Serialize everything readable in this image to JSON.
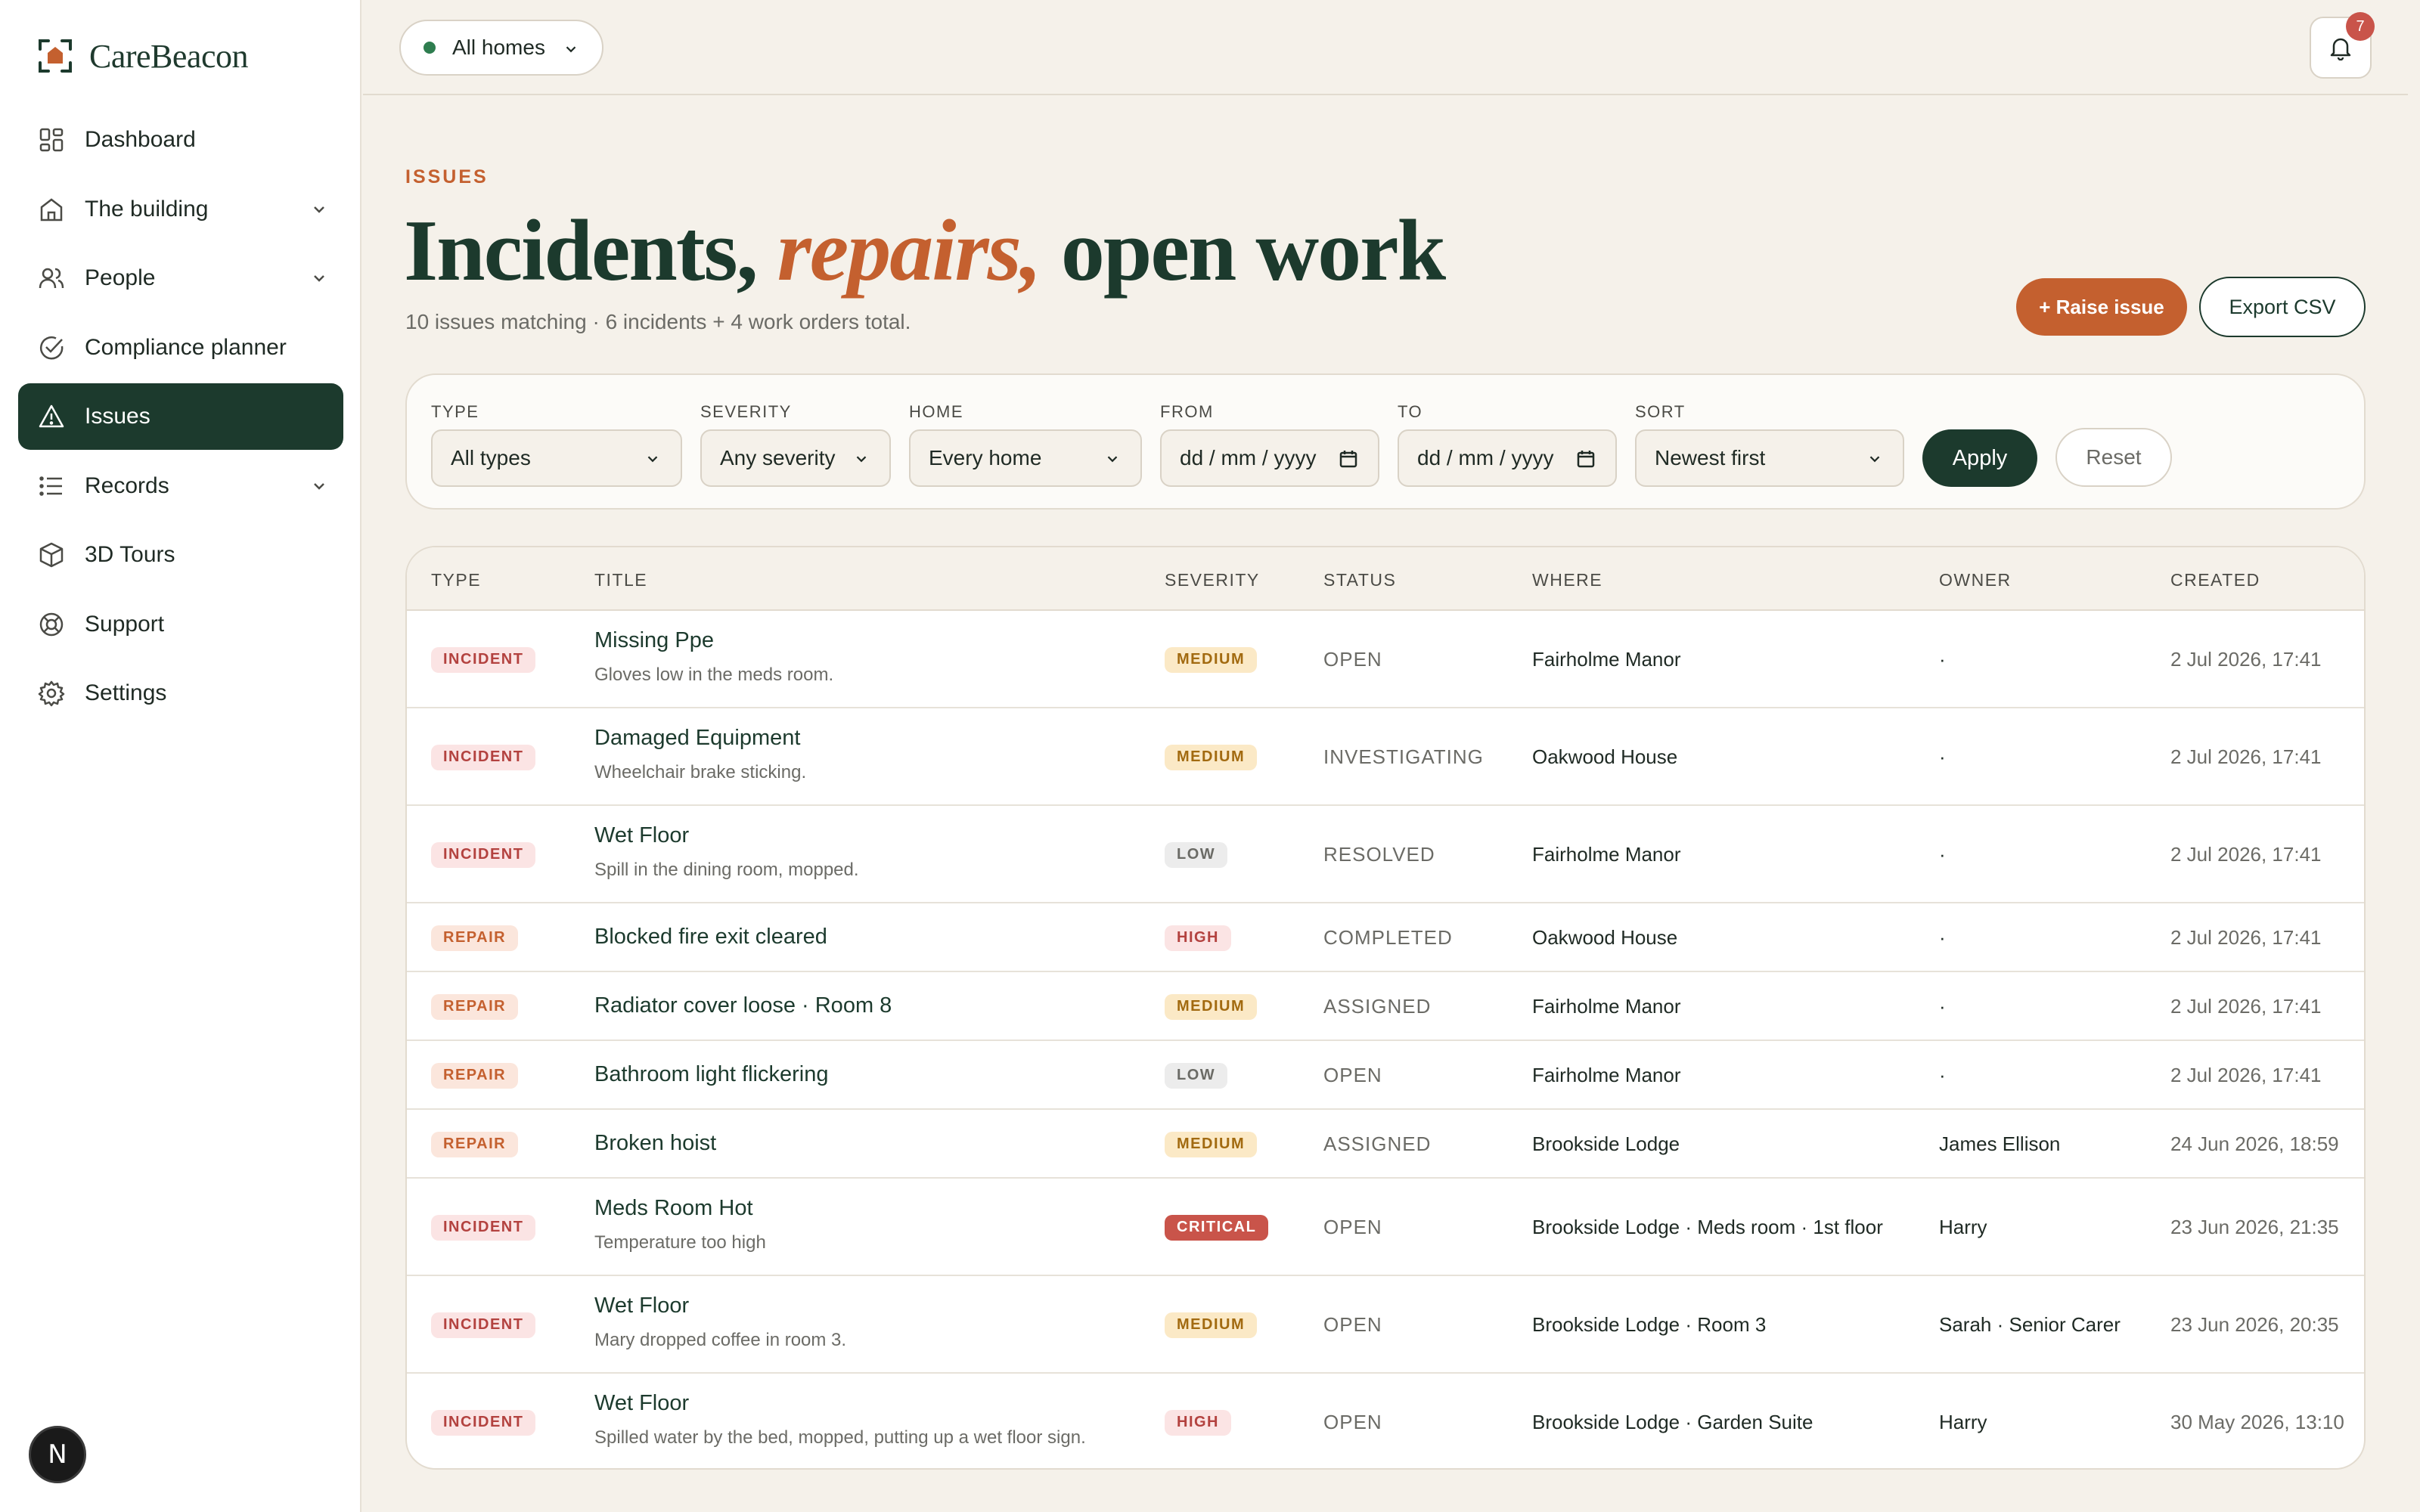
{
  "brand": {
    "name": "CareBeacon"
  },
  "sidebar": {
    "items": [
      {
        "label": "Dashboard",
        "icon": "dashboard-grid-icon",
        "expandable": false,
        "active": false
      },
      {
        "label": "The building",
        "icon": "building-icon",
        "expandable": true,
        "active": false
      },
      {
        "label": "People",
        "icon": "people-icon",
        "expandable": true,
        "active": false
      },
      {
        "label": "Compliance planner",
        "icon": "check-circle-icon",
        "expandable": false,
        "active": false
      },
      {
        "label": "Issues",
        "icon": "warning-triangle-icon",
        "expandable": false,
        "active": true
      },
      {
        "label": "Records",
        "icon": "list-icon",
        "expandable": true,
        "active": false
      },
      {
        "label": "3D Tours",
        "icon": "cube-icon",
        "expandable": false,
        "active": false
      },
      {
        "label": "Support",
        "icon": "lifebuoy-icon",
        "expandable": false,
        "active": false
      },
      {
        "label": "Settings",
        "icon": "gear-icon",
        "expandable": false,
        "active": false
      }
    ],
    "badge": "N"
  },
  "topbar": {
    "home_select": "All homes",
    "notifications_count": "7"
  },
  "header": {
    "eyebrow": "ISSUES",
    "title_part1": "Incidents, ",
    "title_accent": "repairs,",
    "title_part2": " open work",
    "subtitle": "10 issues matching · 6 incidents + 4 work orders total.",
    "raise_label": "+ Raise issue",
    "export_label": "Export CSV"
  },
  "filters": {
    "type": {
      "label": "TYPE",
      "value": "All types"
    },
    "severity": {
      "label": "SEVERITY",
      "value": "Any severity"
    },
    "home": {
      "label": "HOME",
      "value": "Every home"
    },
    "from": {
      "label": "FROM",
      "value": "dd / mm / yyyy"
    },
    "to": {
      "label": "TO",
      "value": "dd / mm / yyyy"
    },
    "sort": {
      "label": "SORT",
      "value": "Newest first"
    },
    "apply_label": "Apply",
    "reset_label": "Reset"
  },
  "table": {
    "columns": [
      "TYPE",
      "TITLE",
      "SEVERITY",
      "STATUS",
      "WHERE",
      "OWNER",
      "CREATED"
    ],
    "rows": [
      {
        "type": "INCIDENT",
        "title": "Missing Ppe",
        "sub": "Gloves low in the meds room.",
        "severity": "MEDIUM",
        "status": "OPEN",
        "where": "Fairholme Manor",
        "owner": "·",
        "created": "2 Jul 2026, 17:41"
      },
      {
        "type": "INCIDENT",
        "title": "Damaged Equipment",
        "sub": "Wheelchair brake sticking.",
        "severity": "MEDIUM",
        "status": "INVESTIGATING",
        "where": "Oakwood House",
        "owner": "·",
        "created": "2 Jul 2026, 17:41"
      },
      {
        "type": "INCIDENT",
        "title": "Wet Floor",
        "sub": "Spill in the dining room, mopped.",
        "severity": "LOW",
        "status": "RESOLVED",
        "where": "Fairholme Manor",
        "owner": "·",
        "created": "2 Jul 2026, 17:41"
      },
      {
        "type": "REPAIR",
        "title": "Blocked fire exit cleared",
        "sub": "",
        "severity": "HIGH",
        "status": "COMPLETED",
        "where": "Oakwood House",
        "owner": "·",
        "created": "2 Jul 2026, 17:41"
      },
      {
        "type": "REPAIR",
        "title": "Radiator cover loose · Room 8",
        "sub": "",
        "severity": "MEDIUM",
        "status": "ASSIGNED",
        "where": "Fairholme Manor",
        "owner": "·",
        "created": "2 Jul 2026, 17:41"
      },
      {
        "type": "REPAIR",
        "title": "Bathroom light flickering",
        "sub": "",
        "severity": "LOW",
        "status": "OPEN",
        "where": "Fairholme Manor",
        "owner": "·",
        "created": "2 Jul 2026, 17:41"
      },
      {
        "type": "REPAIR",
        "title": "Broken hoist",
        "sub": "",
        "severity": "MEDIUM",
        "status": "ASSIGNED",
        "where": "Brookside Lodge",
        "owner": "James Ellison",
        "created": "24 Jun 2026, 18:59"
      },
      {
        "type": "INCIDENT",
        "title": "Meds Room Hot",
        "sub": "Temperature too high",
        "severity": "CRITICAL",
        "status": "OPEN",
        "where": "Brookside Lodge · Meds room · 1st floor",
        "owner": "Harry",
        "created": "23 Jun 2026, 21:35"
      },
      {
        "type": "INCIDENT",
        "title": "Wet Floor",
        "sub": "Mary dropped coffee in room 3.",
        "severity": "MEDIUM",
        "status": "OPEN",
        "where": "Brookside Lodge · Room 3",
        "owner": "Sarah · Senior Carer",
        "created": "23 Jun 2026, 20:35"
      },
      {
        "type": "INCIDENT",
        "title": "Wet Floor",
        "sub": "Spilled water by the bed, mopped, putting up a wet floor sign.",
        "severity": "HIGH",
        "status": "OPEN",
        "where": "Brookside Lodge · Garden Suite",
        "owner": "Harry",
        "created": "30 May 2026, 13:10"
      }
    ]
  },
  "colors": {
    "brand_dark": "#1c3a2d",
    "accent": "#c4602f",
    "background": "#f5f1ea",
    "critical": "#c9544a"
  }
}
